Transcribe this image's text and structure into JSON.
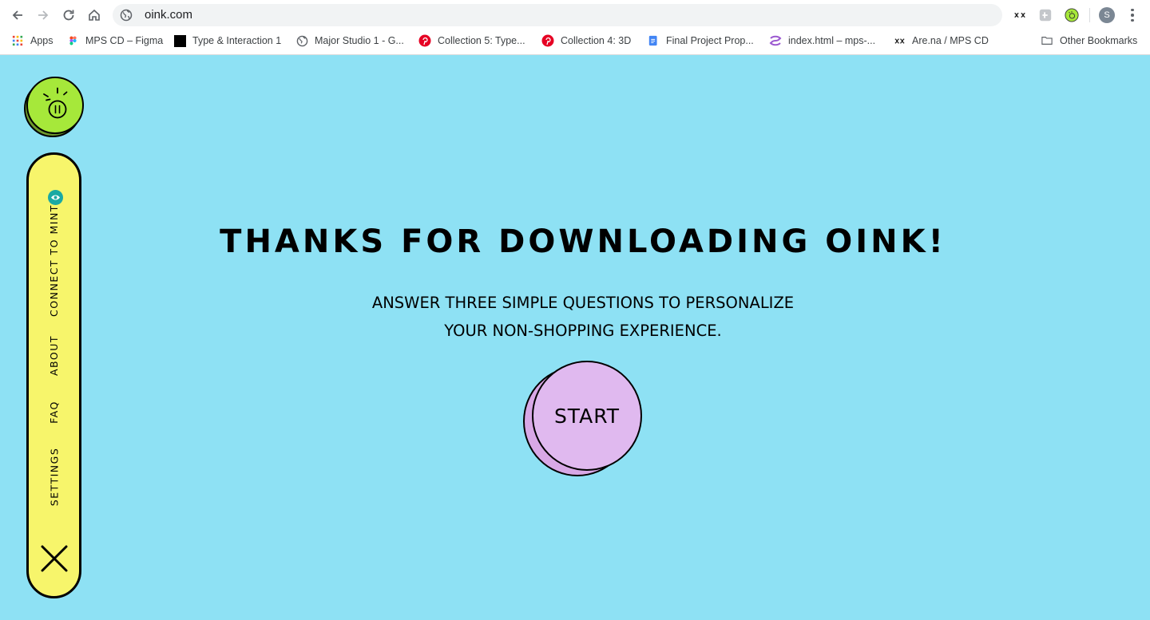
{
  "browser": {
    "url": "oink.com",
    "profile_initial": "S",
    "bookmarks": [
      {
        "label": "Apps",
        "icon": "apps-grid-icon"
      },
      {
        "label": "MPS CD – Figma",
        "icon": "figma-icon"
      },
      {
        "label": "Type & Interaction 1",
        "icon": "black-square-icon"
      },
      {
        "label": "Major Studio 1 - G...",
        "icon": "globe-icon"
      },
      {
        "label": "Collection 5: Type...",
        "icon": "pinterest-icon"
      },
      {
        "label": "Collection 4: 3D",
        "icon": "pinterest-icon"
      },
      {
        "label": "Final Project Prop...",
        "icon": "google-docs-icon"
      },
      {
        "label": "index.html – mps-...",
        "icon": "glitch-icon"
      },
      {
        "label": "Are.na / MPS CD",
        "icon": "arena-icon"
      },
      {
        "label": "Other Bookmarks",
        "icon": "folder-icon"
      }
    ]
  },
  "sidebar": {
    "items": [
      {
        "label": "CONNECT TO MINT"
      },
      {
        "label": "ABOUT"
      },
      {
        "label": "FAQ"
      },
      {
        "label": "SETTINGS"
      }
    ]
  },
  "main": {
    "title": "THANKS FOR DOWNLOADING OINK!",
    "subtitle_line1": "ANSWER THREE SIMPLE QUESTIONS TO PERSONALIZE",
    "subtitle_line2": "YOUR NON-SHOPPING EXPERIENCE.",
    "start_label": "START"
  },
  "colors": {
    "background": "#8ee1f4",
    "sidebar": "#f7f56b",
    "logo": "#a6e83a",
    "start_button": "#e0b9ef",
    "mint": "#1aa9a3"
  }
}
